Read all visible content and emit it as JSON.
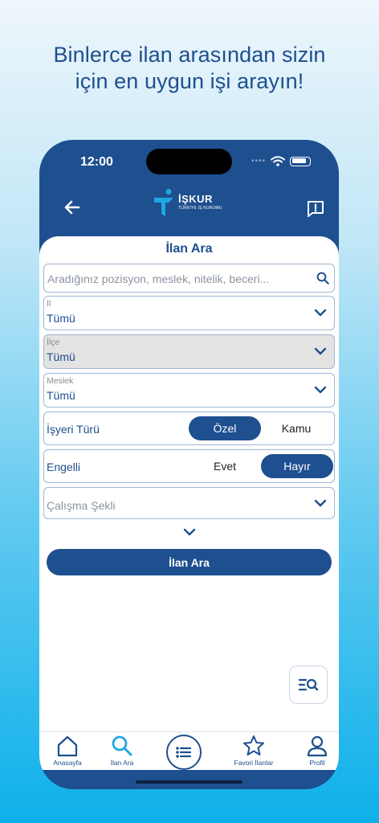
{
  "headline": {
    "line1": "Binlerce ilan arasından sizin",
    "line2": "için en uygun işi arayın!"
  },
  "status_bar": {
    "time": "12:00"
  },
  "header": {
    "logo_title": "İŞKUR",
    "logo_subtitle": "TÜRKİYE İŞ KURUMU"
  },
  "page_title": "İlan Ara",
  "search": {
    "placeholder": "Aradığınız pozisyon, meslek, nitelik, beceri..."
  },
  "filters": {
    "il": {
      "label": "İl",
      "value": "Tümü"
    },
    "ilce": {
      "label": "İlçe",
      "value": "Tümü"
    },
    "meslek": {
      "label": "Meslek",
      "value": "Tümü"
    },
    "isyeri_turu": {
      "label": "İşyeri Türü",
      "options": [
        "Özel",
        "Kamu"
      ],
      "selected": "Özel"
    },
    "engelli": {
      "label": "Engelli",
      "options": [
        "Evet",
        "Hayır"
      ],
      "selected": "Hayır"
    },
    "calisma_sekli": {
      "placeholder": "Çalışma Şekli"
    }
  },
  "submit_label": "İlan Ara",
  "tabs": [
    {
      "label": "Anasayfa",
      "icon": "home-icon"
    },
    {
      "label": "İlan Ara",
      "icon": "search-icon"
    },
    {
      "label": "",
      "icon": "list-icon"
    },
    {
      "label": "Favori İlanlar",
      "icon": "star-icon"
    },
    {
      "label": "Profil",
      "icon": "user-icon"
    }
  ],
  "colors": {
    "primary": "#1e4f8f",
    "accent": "#1ea8e0"
  }
}
